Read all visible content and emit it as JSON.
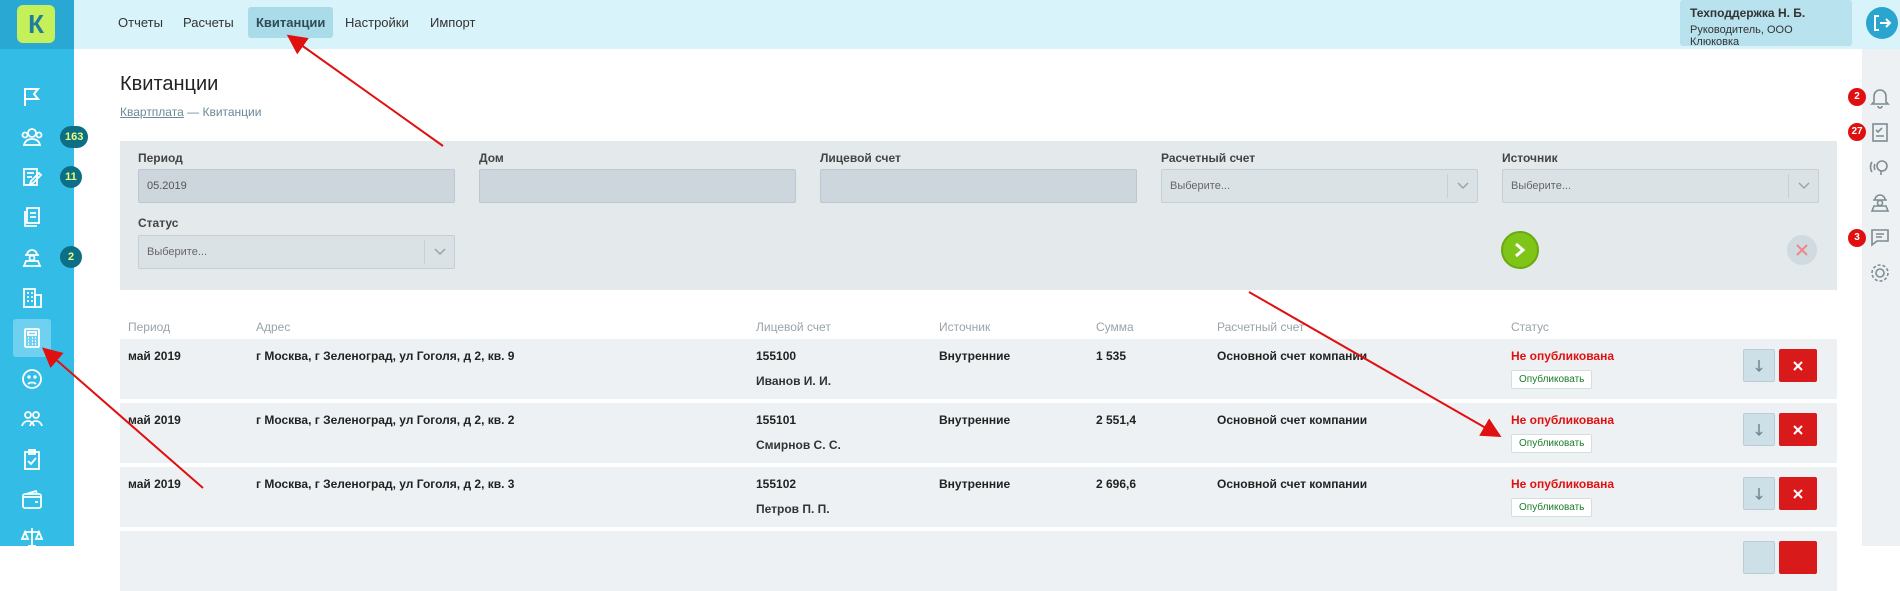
{
  "app": {
    "logo_letter": "К",
    "accent": "#33bde6",
    "accent_dark": "#29a8d4",
    "topbar_bg": "#d8f3fa",
    "error_red": "#e01010",
    "success_green": "#7ec518"
  },
  "topnav": {
    "tabs": [
      "Отчеты",
      "Расчеты",
      "Квитанции",
      "Настройки",
      "Импорт"
    ],
    "active_tab": "Квитанции"
  },
  "user": {
    "name": "Техподдержка Н. Б.",
    "role": "Руководитель, ООО Клюковка"
  },
  "sidebar": {
    "items": [
      {
        "icon": "flag-icon"
      },
      {
        "icon": "people-icon",
        "badge": "163"
      },
      {
        "icon": "edit-icon",
        "badge": "11"
      },
      {
        "icon": "documents-icon"
      },
      {
        "icon": "worker-icon",
        "badge": "2"
      },
      {
        "icon": "building-icon"
      },
      {
        "icon": "calculator-icon",
        "active": true
      },
      {
        "icon": "sad-face-icon"
      },
      {
        "icon": "team-icon"
      },
      {
        "icon": "clipboard-icon"
      },
      {
        "icon": "wallet-icon"
      },
      {
        "icon": "scales-icon"
      }
    ]
  },
  "rightbar": {
    "items": [
      {
        "icon": "bell-icon",
        "badge": "2"
      },
      {
        "icon": "checklist-icon",
        "badge": "27"
      },
      {
        "icon": "broadcast-icon"
      },
      {
        "icon": "worker-icon"
      },
      {
        "icon": "chat-icon",
        "badge": "3"
      },
      {
        "icon": "gear-icon"
      }
    ]
  },
  "page": {
    "title": "Квитанции",
    "breadcrumb_link": "Квартплата",
    "breadcrumb_separator": "—",
    "breadcrumb_current": "Квитанции"
  },
  "filters": {
    "period_label": "Период",
    "period_value": "05.2019",
    "house_label": "Дом",
    "house_value": "",
    "account_label": "Лицевой счет",
    "account_value": "",
    "settlement_label": "Расчетный счет",
    "settlement_placeholder": "Выберите...",
    "source_label": "Источник",
    "source_placeholder": "Выберите...",
    "status_label": "Статус",
    "status_placeholder": "Выберите..."
  },
  "table": {
    "headers": [
      "Период",
      "Адрес",
      "Лицевой счет",
      "Источник",
      "Сумма",
      "Расчетный счет",
      "Статус"
    ],
    "publish_label": "Опубликовать",
    "rows": [
      {
        "period": "май 2019",
        "address": "г Москва, г Зеленоград, ул Гоголя, д 2, кв. 9",
        "account": "155100",
        "owner": "Иванов И. И.",
        "source": "Внутренние",
        "sum": "1 535",
        "settlement": "Основной счет компании",
        "status": "Не опубликована"
      },
      {
        "period": "май 2019",
        "address": "г Москва, г Зеленоград, ул Гоголя, д 2, кв. 2",
        "account": "155101",
        "owner": "Смирнов С. С.",
        "source": "Внутренние",
        "sum": "2 551,4",
        "settlement": "Основной счет компании",
        "status": "Не опубликована"
      },
      {
        "period": "май 2019",
        "address": "г Москва, г Зеленоград, ул Гоголя, д 2, кв. 3",
        "account": "155102",
        "owner": "Петров П. П.",
        "source": "Внутренние",
        "sum": "2 696,6",
        "settlement": "Основной счет компании",
        "status": "Не опубликована"
      }
    ]
  }
}
